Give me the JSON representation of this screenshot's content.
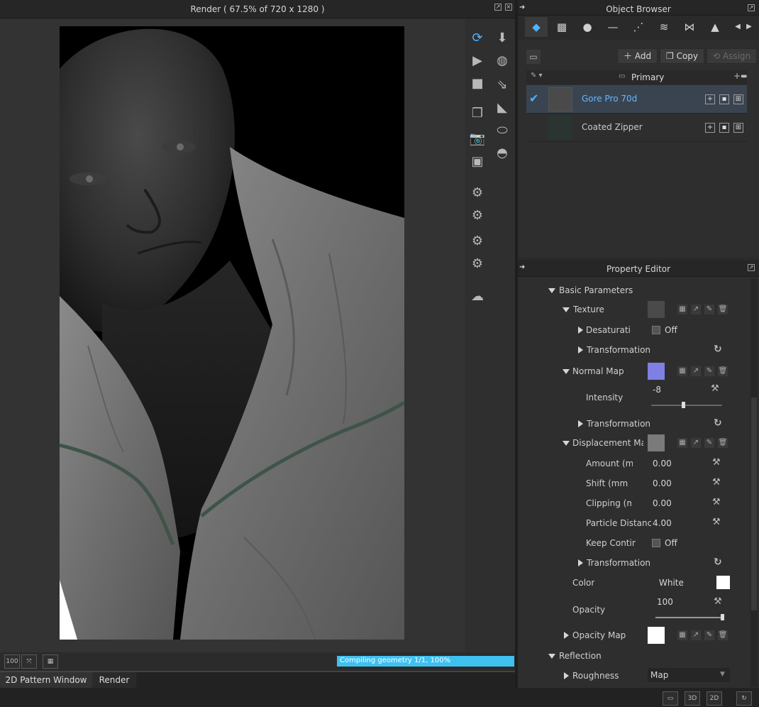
{
  "render_window": {
    "title": "Render ( 67.5% of 720 x 1280 )",
    "progress_text": "Compiling geometry 1/1, 100%",
    "progress": 1.0,
    "zoom_button": "100"
  },
  "bottom_tabs": [
    "2D Pattern Window",
    "Render"
  ],
  "object_browser": {
    "title": "Object Browser",
    "tabs": [
      "fabric-icon",
      "texture-icon",
      "button-icon",
      "topstitch-icon",
      "line-icon",
      "zipper-icon",
      "bow-icon",
      "trim-icon"
    ],
    "add_label": "Add",
    "copy_label": "Copy",
    "assign_label": "Assign",
    "group_label": "Primary",
    "materials": [
      {
        "name": "Gore Pro 70d",
        "selected": true,
        "swatch": "#4a4a4a"
      },
      {
        "name": "Coated Zipper",
        "selected": false,
        "swatch": "#2a3430"
      }
    ]
  },
  "property_editor": {
    "title": "Property Editor",
    "basic_parameters": "Basic Parameters",
    "texture": "Texture",
    "desaturate": "Desaturatic",
    "desaturate_value": "Off",
    "transformation": "Transformation",
    "normal_map": "Normal Map",
    "normal_map_color": "#7f7fe6",
    "intensity": "Intensity",
    "intensity_value": "-8",
    "displacement_map": "Displacement Map",
    "amount": "Amount (mı",
    "amount_value": "0.00",
    "shift": "Shift (mm",
    "shift_value": "0.00",
    "clipping": "Clipping (mr",
    "clipping_value": "0.00",
    "particle_distance": "Particle Distance",
    "particle_distance_value": "4.00",
    "keep_continuity": "Keep Contin",
    "keep_continuity_value": "Off",
    "color": "Color",
    "color_value": "White",
    "opacity": "Opacity",
    "opacity_value": "100",
    "opacity_map": "Opacity Map",
    "reflection": "Reflection",
    "roughness": "Roughness",
    "roughness_value": "Map"
  },
  "status_bar": {
    "btn_3d": "3D",
    "btn_2d": "2D"
  }
}
